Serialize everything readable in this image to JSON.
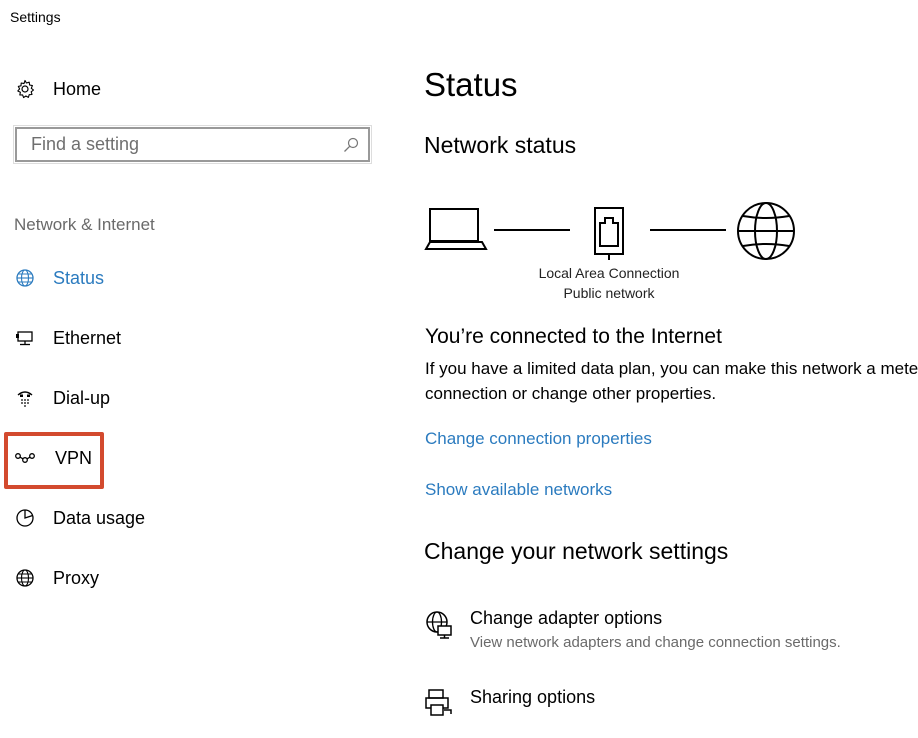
{
  "window": {
    "title": "Settings"
  },
  "sidebar": {
    "home_label": "Home",
    "search_placeholder": "Find a setting",
    "section_label": "Network & Internet",
    "items": [
      {
        "label": "Status",
        "icon": "globe-icon",
        "active": true
      },
      {
        "label": "Ethernet",
        "icon": "ethernet-icon"
      },
      {
        "label": "Dial-up",
        "icon": "dialup-icon"
      },
      {
        "label": "VPN",
        "icon": "vpn-icon",
        "highlighted": true
      },
      {
        "label": "Data usage",
        "icon": "data-usage-icon"
      },
      {
        "label": "Proxy",
        "icon": "globe-icon"
      }
    ]
  },
  "main": {
    "title": "Status",
    "network_status_heading": "Network status",
    "connection_name": "Local Area Connection",
    "network_type": "Public network",
    "connected_title": "You’re connected to the Internet",
    "connected_desc": "If you have a limited data plan, you can make this network a metered connection or change other properties.",
    "link_change_properties": "Change connection properties",
    "link_show_networks": "Show available networks",
    "change_settings_heading": "Change your network settings",
    "options": [
      {
        "title": "Change adapter options",
        "desc": "View network adapters and change connection settings.",
        "icon": "adapter-icon"
      },
      {
        "title": "Sharing options",
        "desc": "",
        "icon": "sharing-icon"
      }
    ]
  },
  "colors": {
    "accent": "#2b7bbf",
    "highlight_box": "#d34a2e",
    "muted_text": "#6a6a6a"
  }
}
